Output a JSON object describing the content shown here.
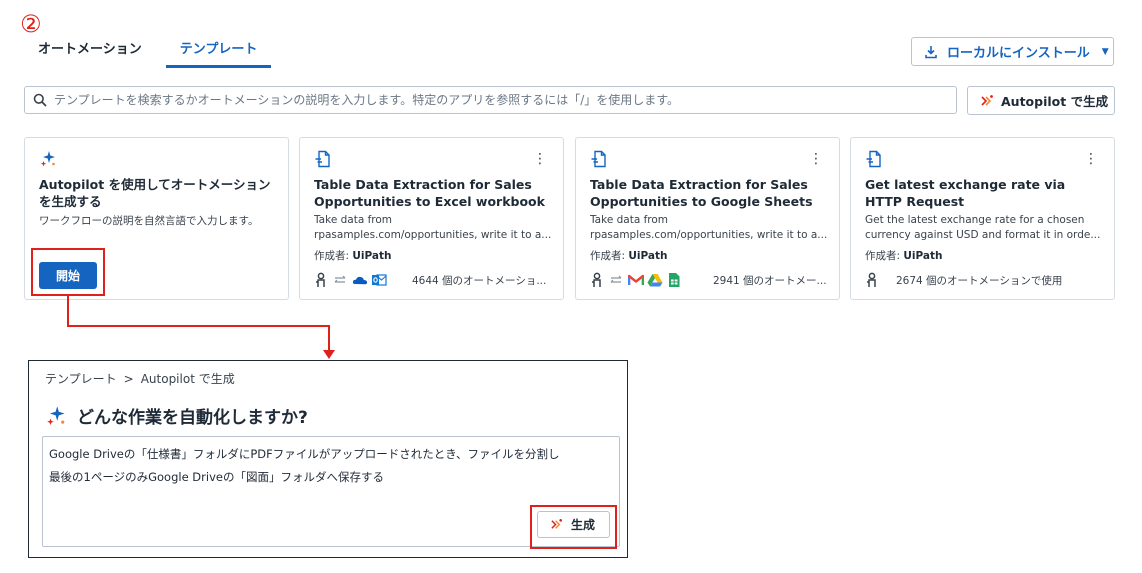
{
  "annotation": {
    "step_number": "②"
  },
  "tabs": [
    {
      "label": "オートメーション",
      "active": false
    },
    {
      "label": "テンプレート",
      "active": true
    }
  ],
  "install_button": {
    "label": "ローカルにインストール",
    "icon": "download-icon"
  },
  "search": {
    "placeholder": "テンプレートを検索するかオートメーションの説明を入力します。特定のアプリを参照するには「/」を使用します。"
  },
  "autopilot_button": {
    "label": "Autopilot で生成"
  },
  "cards": [
    {
      "type": "autopilot",
      "title": "Autopilot を使用してオートメーションを生成する",
      "description": "ワークフローの説明を自然言語で入力します。",
      "button_label": "開始"
    },
    {
      "type": "template",
      "title": "Table Data Extraction for Sales Opportunities to Excel workbook",
      "description_lines": [
        "Take data from",
        "rpasamples.com/opportunities, write it to a..."
      ],
      "author_label": "作成者: ",
      "author": "UiPath",
      "apps": [
        "uipath-robot-icon",
        "arrows-icon",
        "onedrive-icon",
        "outlook-icon"
      ],
      "usage": "4644 個のオートメーショ..."
    },
    {
      "type": "template",
      "title": "Table Data Extraction for Sales Opportunities to Google Sheets",
      "description_lines": [
        "Take data from",
        "rpasamples.com/opportunities, write it to a..."
      ],
      "author_label": "作成者: ",
      "author": "UiPath",
      "apps": [
        "uipath-robot-icon",
        "arrows-icon",
        "gmail-icon",
        "google-drive-icon",
        "google-sheets-icon"
      ],
      "usage": "2941 個のオートメー..."
    },
    {
      "type": "template",
      "title": "Get latest exchange rate via HTTP Request",
      "description_lines": [
        "Get the latest exchange rate for a chosen",
        "currency against USD and format it in orde..."
      ],
      "author_label": "作成者: ",
      "author": "UiPath",
      "apps": [
        "uipath-robot-icon"
      ],
      "usage": "2674 個のオートメーションで使用"
    }
  ],
  "panel": {
    "breadcrumb": [
      "テンプレート",
      "Autopilot で生成"
    ],
    "breadcrumb_separator": ">",
    "heading": "どんな作業を自動化しますか?",
    "prompt_lines": [
      "Google Driveの「仕様書」フォルダにPDFファイルがアップロードされたとき、ファイルを分割し",
      "最後の1ページのみGoogle Driveの「図面」フォルダへ保存する"
    ],
    "generate_label": "生成"
  },
  "colors": {
    "accent": "#1565c0",
    "annotation_red": "#e0201b"
  }
}
